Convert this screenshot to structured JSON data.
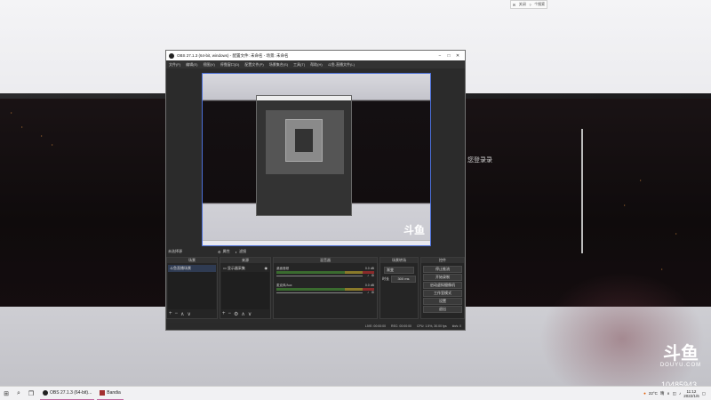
{
  "desktop": {
    "login_text": "您登录录",
    "top_right_box": [
      "✉",
      "关闭",
      "?",
      "个搜索"
    ],
    "watermark": {
      "brand_mark": "斗鱼",
      "brand_text": "DOUYU.COM",
      "room_id": "10485943"
    }
  },
  "obs": {
    "title": "OBS 27.1.3 (64-bit, windows) - 配置文件: 未命名 - 场景: 未命名",
    "menu": [
      "文件(F)",
      "编辑(E)",
      "视图(V)",
      "停靠窗口(D)",
      "配置文件(P)",
      "场景集合(S)",
      "工具(T)",
      "帮助(H)",
      "斗鱼-直播文件(L)"
    ],
    "dock_labels": {
      "scene_label": "未选择源",
      "props": "属性",
      "filters": "滤镜"
    },
    "scenes": {
      "header": "场景",
      "items": [
        "斗鱼直播场景"
      ]
    },
    "sources": {
      "header": "来源",
      "items": [
        "显示器采集"
      ]
    },
    "mixer": {
      "header": "混音器",
      "tracks": [
        {
          "name": "桌面音频",
          "db": "0.0 dB"
        },
        {
          "name": "麦克风/Aux",
          "db": "0.0 dB"
        }
      ]
    },
    "transitions": {
      "header": "场景转场",
      "type": "渐变",
      "duration_label": "时长",
      "duration_value": "300 ms"
    },
    "controls": {
      "header": "控件",
      "buttons": [
        "停止推流",
        "开始录制",
        "启动虚拟摄像机",
        "工作室模式",
        "设置",
        "退出"
      ]
    },
    "status": {
      "live": "LIVE: 00:00:00",
      "rec": "REC: 00:00:00",
      "cpu": "CPU: 1.5%, 30.00 fps",
      "kbps": "kb/s: 0"
    },
    "footer_symbols": [
      "+",
      "−",
      "⚙",
      "∧",
      "∨"
    ]
  },
  "taskbar": {
    "apps": [
      {
        "label": "OBS 27.1.3 (64-bit)...",
        "color": "#222222"
      },
      {
        "label": "Bandia",
        "color": "#a23030"
      }
    ],
    "tray": {
      "temp": "22°C",
      "weather": "晴",
      "time": "11:12",
      "date": "2022/1/6"
    }
  },
  "colors": {
    "accent": "#4b6fd8",
    "douyu_accent": "#ff6a00",
    "obs_bg": "#2b2b2b"
  }
}
